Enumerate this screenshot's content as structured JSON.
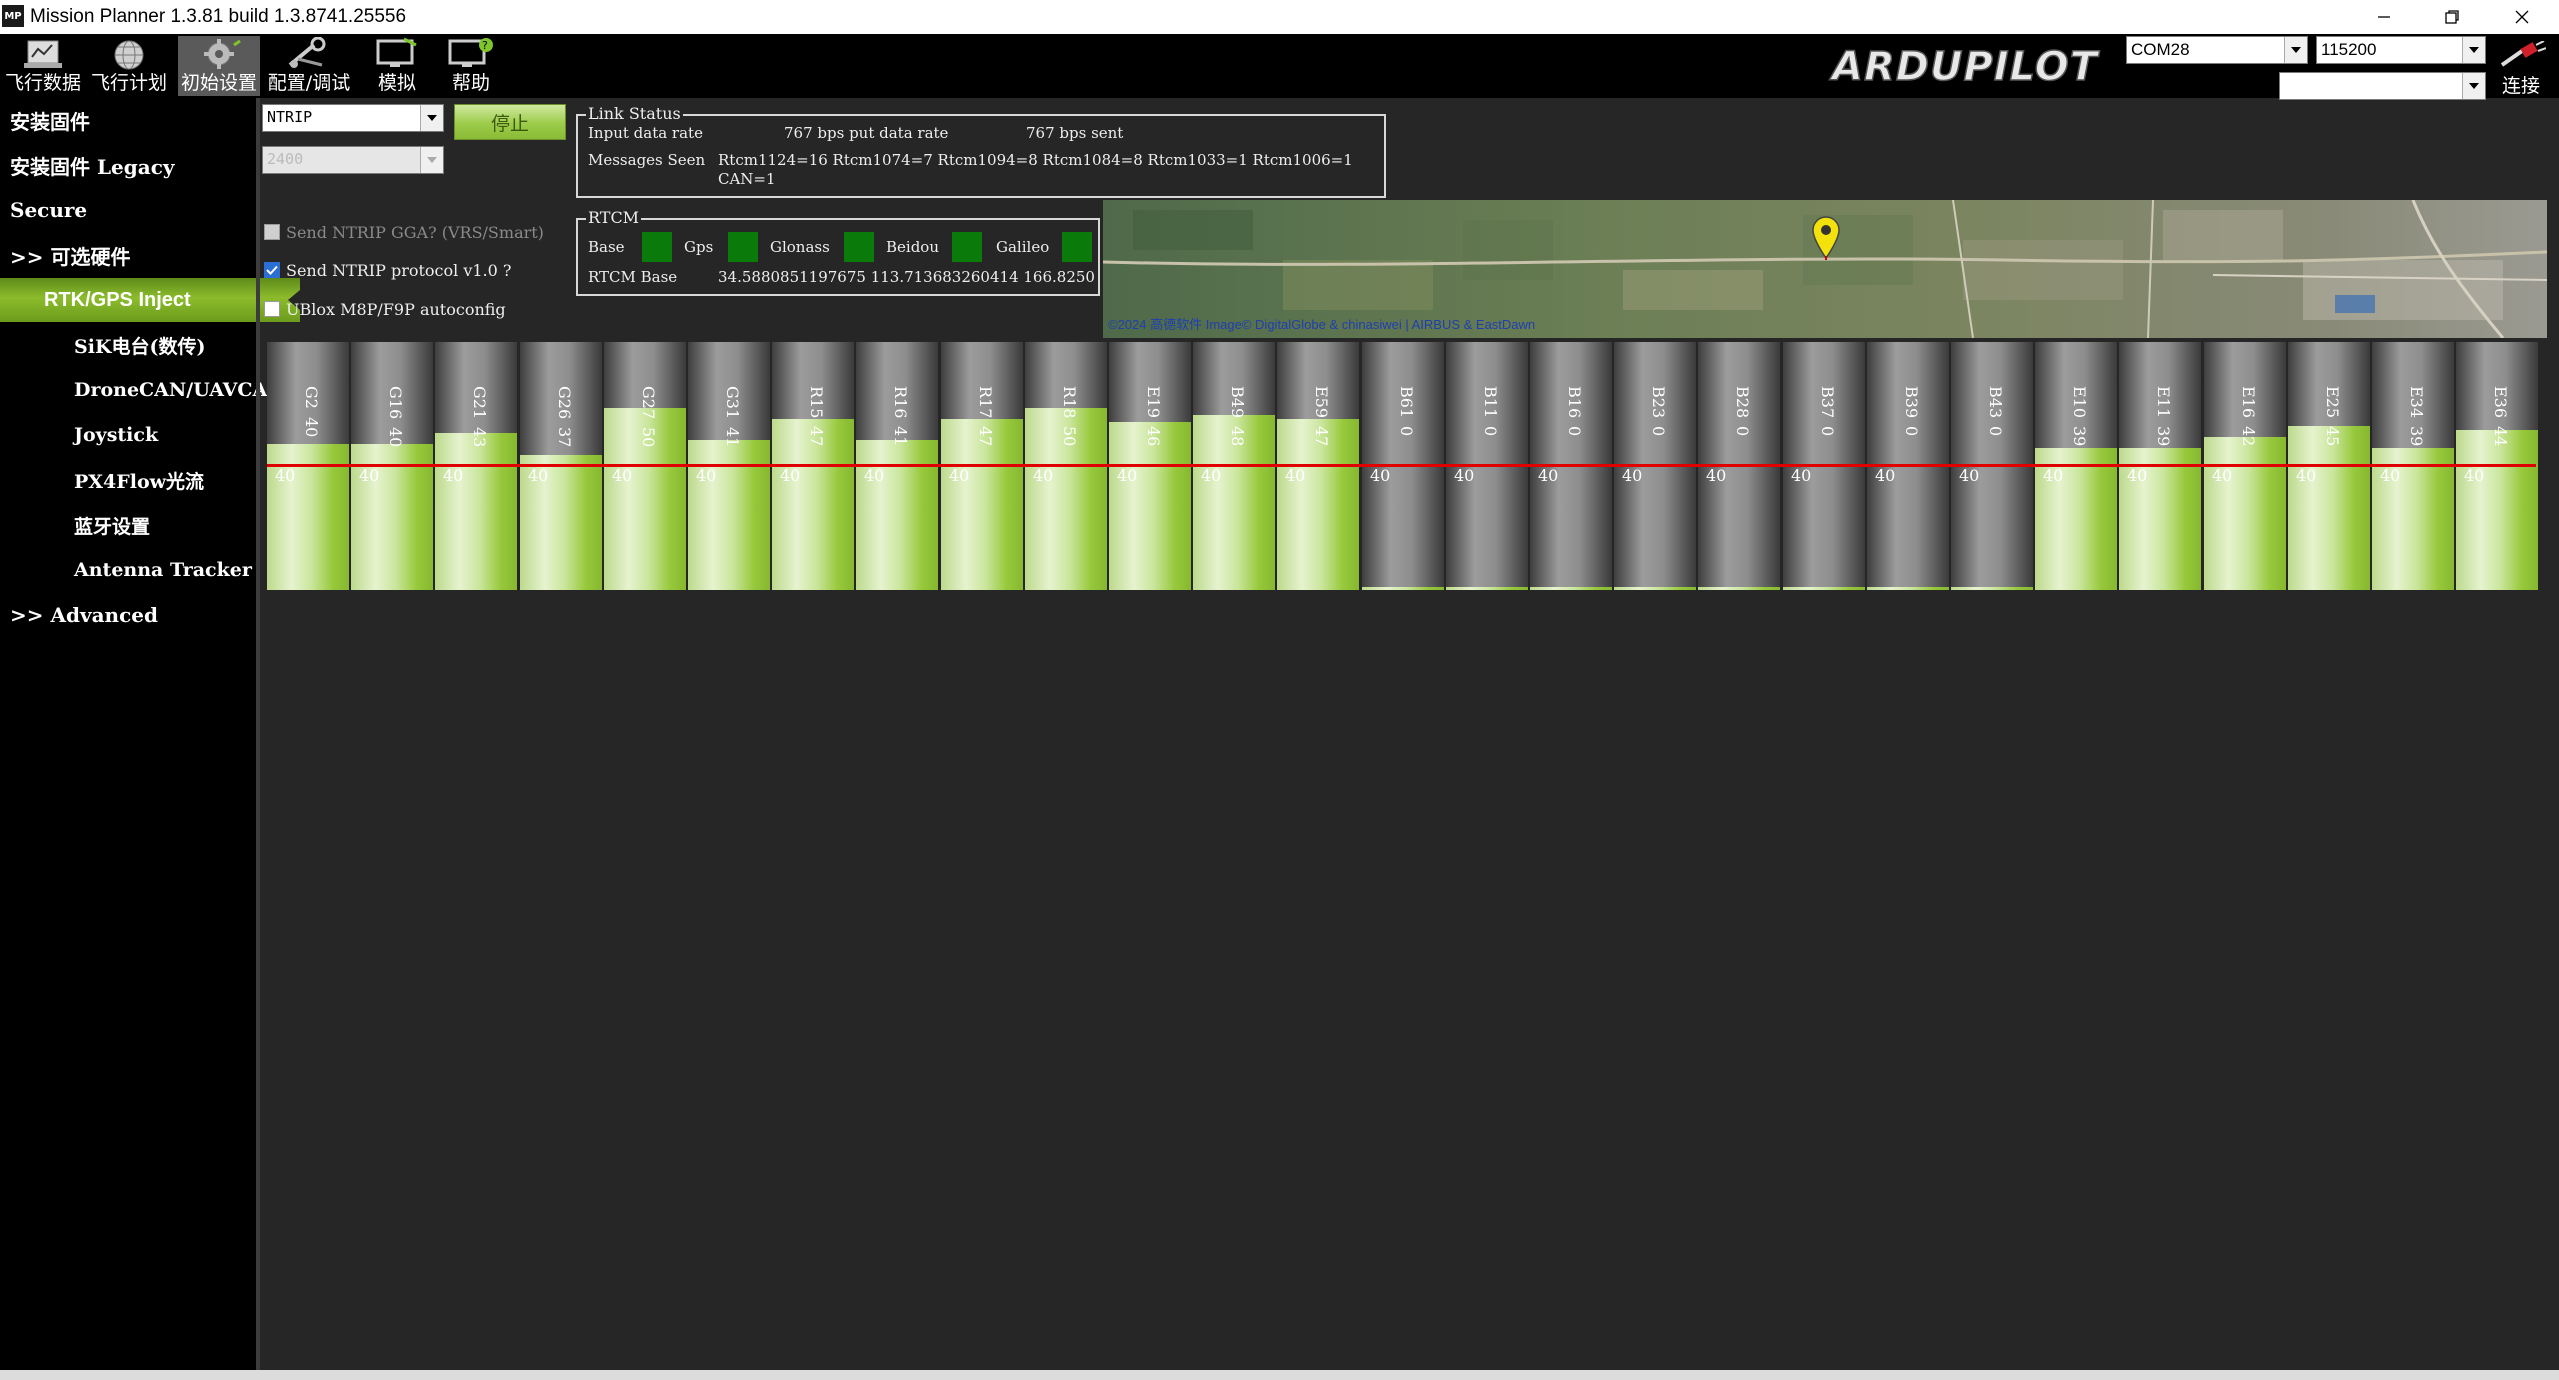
{
  "window": {
    "title": "Mission Planner 1.3.81 build 1.3.8741.25556",
    "app_icon_text": "MP"
  },
  "toolbar": {
    "items": [
      {
        "label": "飞行数据",
        "icon": "flight-data-icon"
      },
      {
        "label": "飞行计划",
        "icon": "flight-plan-globe-icon"
      },
      {
        "label": "初始设置",
        "icon": "initial-setup-icon"
      },
      {
        "label": "配置/调试",
        "icon": "config-tuning-icon"
      },
      {
        "label": "模拟",
        "icon": "simulation-icon"
      },
      {
        "label": "帮助",
        "icon": "help-icon"
      }
    ],
    "active_index": 2,
    "logo_text": "ARDUPILOT",
    "port": "COM28",
    "baud": "115200",
    "extra_combo": "",
    "connect_label": "连接"
  },
  "sidebar": {
    "items": [
      {
        "label": "安装固件",
        "level": "top"
      },
      {
        "label": "安装固件 Legacy",
        "level": "top"
      },
      {
        "label": "Secure",
        "level": "top"
      },
      {
        "label": ">> 可选硬件",
        "level": "top"
      },
      {
        "label": "RTK/GPS Inject",
        "level": "selected"
      },
      {
        "label": "SiK电台(数传)",
        "level": "sub"
      },
      {
        "label": "DroneCAN/UAVCAN",
        "level": "sub"
      },
      {
        "label": "Joystick",
        "level": "sub"
      },
      {
        "label": "PX4Flow光流",
        "level": "sub"
      },
      {
        "label": "蓝牙设置",
        "level": "sub"
      },
      {
        "label": "Antenna Tracker",
        "level": "sub"
      },
      {
        "label": ">> Advanced",
        "level": "top"
      }
    ]
  },
  "inject": {
    "source": "NTRIP",
    "baud": "2400",
    "stop_label": "停止",
    "options": [
      {
        "label": "Send NTRIP GGA? (VRS/Smart)",
        "checked": false,
        "disabled": true
      },
      {
        "label": "Send NTRIP protocol v1.0 ?",
        "checked": true,
        "disabled": false
      },
      {
        "label": "UBlox M8P/F9P autoconfig",
        "checked": false,
        "disabled": false
      }
    ]
  },
  "link_status": {
    "legend": "Link Status",
    "input_label": "Input data rate",
    "input_rate": "767 bps put data rate",
    "sent_rate": "767 bps sent",
    "messages_label": "Messages Seen",
    "messages": "Rtcm1124=16 Rtcm1074=7 Rtcm1094=8 Rtcm1084=8 Rtcm1033=1 Rtcm1006=1",
    "messages_line2": "CAN=1"
  },
  "rtcm": {
    "legend": "RTCM",
    "leds": [
      "Base",
      "Gps",
      "Glonass",
      "Beidou",
      "Galileo"
    ],
    "led_color": "#0a7a0a",
    "base_label": "RTCM Base",
    "base_value": "34.5880851197675 113.713683260414 166.8250"
  },
  "map": {
    "attribution": "©2024 高德软件 Image© DigitalGlobe & chinasiwei | AIRBUS & EastDawn",
    "marker": "location-pin-icon"
  },
  "satellites": {
    "ref_level": 40,
    "max_level": 68,
    "colors": {
      "fill": "#9ccc4a",
      "bar": "#8e8e8e",
      "line": "#e00000"
    },
    "items": [
      {
        "id": "G2",
        "snr": 40
      },
      {
        "id": "G16",
        "snr": 40
      },
      {
        "id": "G21",
        "snr": 43
      },
      {
        "id": "G26",
        "snr": 37
      },
      {
        "id": "G27",
        "snr": 50
      },
      {
        "id": "G31",
        "snr": 41
      },
      {
        "id": "R15",
        "snr": 47
      },
      {
        "id": "R16",
        "snr": 41
      },
      {
        "id": "R17",
        "snr": 47
      },
      {
        "id": "R18",
        "snr": 50
      },
      {
        "id": "E19",
        "snr": 46
      },
      {
        "id": "B49",
        "snr": 48
      },
      {
        "id": "E59",
        "snr": 47
      },
      {
        "id": "B61",
        "snr": 0
      },
      {
        "id": "B11",
        "snr": 0
      },
      {
        "id": "B16",
        "snr": 0
      },
      {
        "id": "B23",
        "snr": 0
      },
      {
        "id": "B28",
        "snr": 0
      },
      {
        "id": "B37",
        "snr": 0
      },
      {
        "id": "B39",
        "snr": 0
      },
      {
        "id": "B43",
        "snr": 0
      },
      {
        "id": "E10",
        "snr": 39
      },
      {
        "id": "E11",
        "snr": 39
      },
      {
        "id": "E16",
        "snr": 42
      },
      {
        "id": "E25",
        "snr": 45
      },
      {
        "id": "E34",
        "snr": 39
      },
      {
        "id": "E36",
        "snr": 44
      }
    ]
  }
}
